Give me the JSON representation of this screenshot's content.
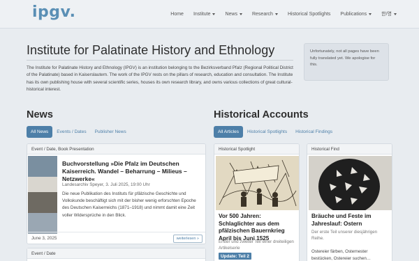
{
  "header": {
    "logo": "ipgv.",
    "nav": [
      {
        "label": "Home",
        "dropdown": false
      },
      {
        "label": "Institute",
        "dropdown": true
      },
      {
        "label": "News",
        "dropdown": true
      },
      {
        "label": "Research",
        "dropdown": true
      },
      {
        "label": "Historical Spotlights",
        "dropdown": false
      },
      {
        "label": "Publications",
        "dropdown": true
      },
      {
        "label": "한/영",
        "dropdown": true
      }
    ]
  },
  "intro": {
    "title": "Institute for Palatinate History and Ethnology",
    "text": "The Institute for Palatinate History and Ethnology (IPGV) is an institution belonging to the Bezirksverband Pfalz (Regional Political District of the Palatinate) based in Kaiserslautern. The work of the IPGV rests on the pillars of research, education and consultation. The Institute has its own publishing house with several scientific series, houses its own research library, and owns various collections of great cultural-historical interest.",
    "notice": "Unfortunately, not all pages have been fully translated yet. We apologise for this."
  },
  "news": {
    "title": "News",
    "tabs": [
      "All News",
      "Events / Dates",
      "Publisher News"
    ],
    "active_tab": "All News",
    "cards": [
      {
        "category": "Event / Date, Book Presentation",
        "title": "Buchvorstellung »Die Pfalz im Deutschen Kaiserreich. Wandel – Beharrung – Milieus – Netzwerke«",
        "subtitle": "Landesarchiv Speyer, 3. Juli 2025, 19:00 Uhr",
        "text": "Die neue Publikation des Instituts für pfälzische Geschichte und Volkskunde beschäftigt sich mit der bisher wenig erforschten Epoche des Deutschen Kaiserreichs (1871–1918) und nimmt damit eine Zeit voller Widersprüche in den Blick.",
        "date": "June 3, 2025",
        "more": "weiterlesen »"
      },
      {
        "category": "Event / Date"
      }
    ]
  },
  "accounts": {
    "title": "Historical Accounts",
    "tabs": [
      "All Articles",
      "Historical Spotlights",
      "Historical Findings"
    ],
    "active_tab": "All Articles",
    "cards": [
      {
        "category": "Historical Spotlight",
        "title": "Vor 500 Jahren: Schlaglichter aus dem pfälzischen Bauernkrieg April bis Juni 1525",
        "subtitle": "Erster und zweiter Teil einer dreiteiligen Artikelserie",
        "badge": "Update: Teil 2"
      },
      {
        "category": "Historical Find",
        "title": "Bräuche und Feste im Jahreslauf: Ostern",
        "subtitle": "Der erste Teil unserer diesjährigen Reihe.",
        "text": "Ostereier färben, Osternester bestücken, Ostereier suchen…"
      }
    ]
  },
  "colors": {
    "accent": "#4d7fa8",
    "logo": "#5a8fb5",
    "background": "#e8ecf0"
  }
}
